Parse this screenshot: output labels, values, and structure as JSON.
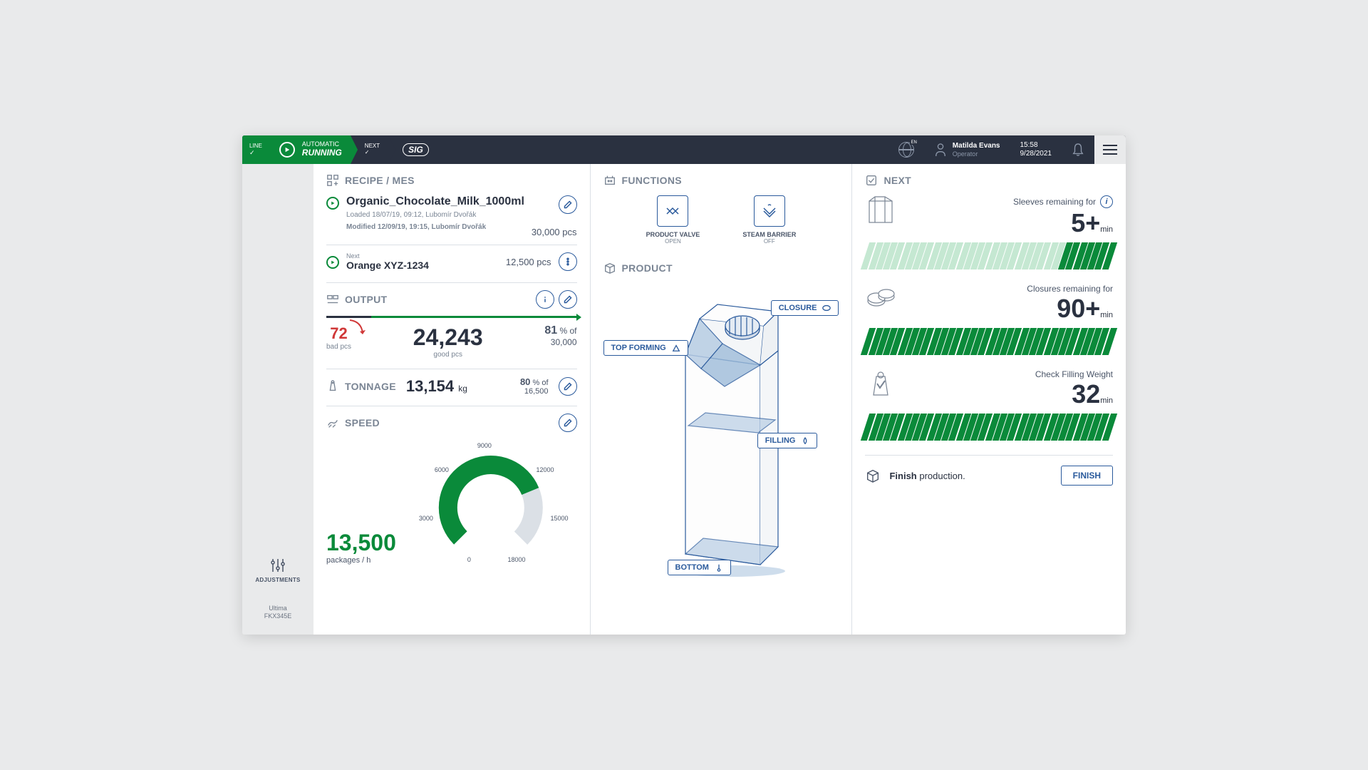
{
  "header": {
    "line_label": "LINE",
    "auto_label": "AUTOMATIC",
    "running": "RUNNING",
    "next_label": "NEXT",
    "logo": "SIG",
    "lang": "EN",
    "user_name": "Matilda Evans",
    "user_role": "Operator",
    "time": "15:58",
    "date": "9/28/2021"
  },
  "sidebar": {
    "adjustments": "ADJUSTMENTS",
    "machine_name": "Ultima",
    "machine_model": "FKX345E"
  },
  "recipe": {
    "title": "RECIPE / MES",
    "current_name": "Organic_Chocolate_Milk_1000ml",
    "loaded": "Loaded 18/07/19, 09:12, Lubomír Dvořák",
    "modified": "Modified 12/09/19, 19:15, Lubomír Dvořák",
    "current_qty": "30,000 pcs",
    "next_label": "Next",
    "next_name": "Orange XYZ-1234",
    "next_qty": "12,500 pcs"
  },
  "output": {
    "title": "OUTPUT",
    "bad_val": "72",
    "bad_lbl": "bad pcs",
    "good_val": "24,243",
    "good_lbl": "good pcs",
    "pct_num": "81",
    "pct_lbl": "% of",
    "pct_total": "30,000",
    "bar_bad_pct": 18,
    "bar_good_pct": 82
  },
  "tonnage": {
    "title": "TONNAGE",
    "val": "13,154",
    "unit": "kg",
    "pct_num": "80",
    "pct_lbl": "% of",
    "pct_total": "16,500"
  },
  "speed": {
    "title": "SPEED",
    "val": "13,500",
    "unit": "packages / h",
    "ticks": [
      "0",
      "3000",
      "6000",
      "9000",
      "12000",
      "15000",
      "18000"
    ]
  },
  "functions": {
    "title": "FUNCTIONS",
    "items": [
      {
        "label": "PRODUCT VALVE",
        "state": "OPEN"
      },
      {
        "label": "STEAM BARRIER",
        "state": "OFF"
      }
    ]
  },
  "product": {
    "title": "PRODUCT",
    "tags": {
      "closure": "CLOSURE",
      "top": "TOP FORMING",
      "filling": "FILLING",
      "bottom": "BOTTOM"
    }
  },
  "next": {
    "title": "NEXT",
    "items": [
      {
        "label": "Sleeves remaining for",
        "val": "5+",
        "unit": "min",
        "filled": 7,
        "total": 34,
        "info": true
      },
      {
        "label": "Closures remaining for",
        "val": "90+",
        "unit": "min",
        "filled": 34,
        "total": 34
      },
      {
        "label": "Check Filling Weight",
        "val": "32",
        "unit": "min",
        "filled": 34,
        "total": 34
      }
    ],
    "finish_text_a": "Finish",
    "finish_text_b": " production.",
    "finish_btn": "FINISH"
  }
}
